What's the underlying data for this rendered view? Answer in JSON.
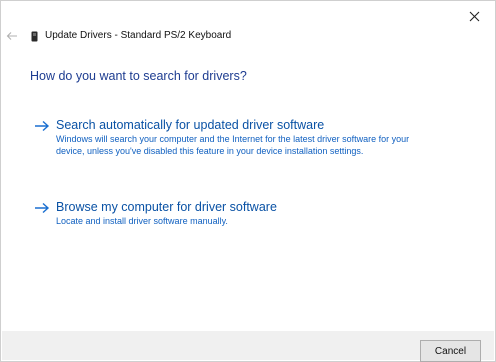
{
  "window": {
    "title": "Update Drivers - Standard PS/2 Keyboard",
    "close_icon": "close-icon",
    "back_icon": "back-arrow-icon",
    "device_icon": "keyboard-device-icon"
  },
  "main": {
    "heading": "How do you want to search for drivers?",
    "options": [
      {
        "title": "Search automatically for updated driver software",
        "description": "Windows will search your computer and the Internet for the latest driver software for your device, unless you've disabled this feature in your device installation settings.",
        "icon": "arrow-right-icon"
      },
      {
        "title": "Browse my computer for driver software",
        "description": "Locate and install driver software manually.",
        "icon": "arrow-right-icon"
      }
    ]
  },
  "footer": {
    "cancel_label": "Cancel"
  },
  "colors": {
    "heading": "#1e3d91",
    "link": "#0a52a5",
    "footer_bg": "#f0f0f0"
  }
}
